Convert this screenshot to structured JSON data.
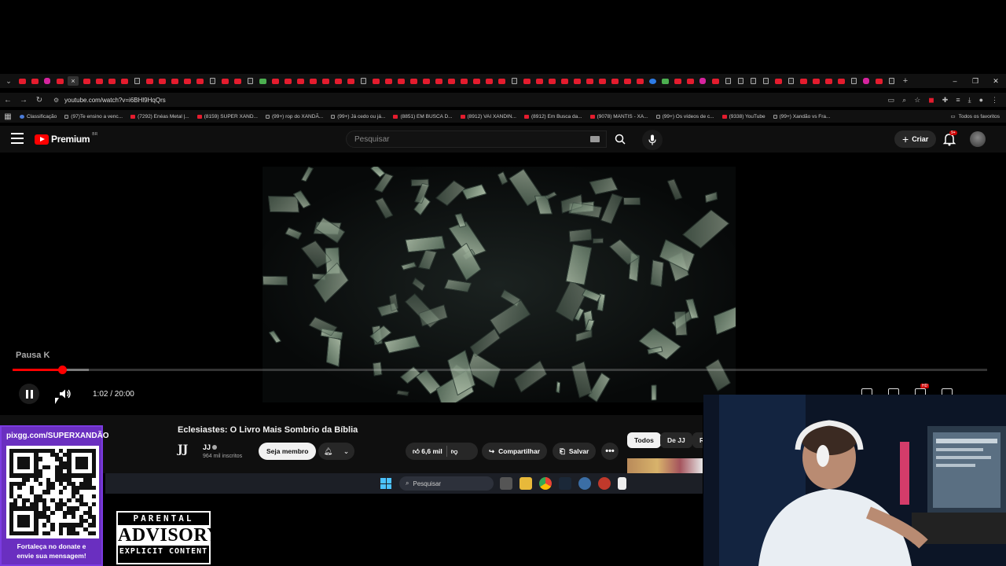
{
  "browser": {
    "url": "youtube.com/watch?v=i6BHl9HqQrs",
    "active_tab_close": "×",
    "new_tab": "+",
    "bookmarks": [
      {
        "label": "Classificação",
        "type": "bl"
      },
      {
        "label": "(97)Te ensino a venc...",
        "type": "tt"
      },
      {
        "label": "(7292) Enéas Metal |...",
        "type": "yt"
      },
      {
        "label": "(8159) SUPER XAND...",
        "type": "yt"
      },
      {
        "label": "(99+) rop do XANDÃ...",
        "type": "tt"
      },
      {
        "label": "(99+) Já cedo ou já...",
        "type": "tt"
      },
      {
        "label": "(8851) EM BUSCA D...",
        "type": "yt"
      },
      {
        "label": "(8912) VAI XANDIN...",
        "type": "yt"
      },
      {
        "label": "(8912) Em Busca da...",
        "type": "yt"
      },
      {
        "label": "(9078) MANTIS - XA...",
        "type": "yt"
      },
      {
        "label": "(99+) Os vídeos de c...",
        "type": "tt"
      },
      {
        "label": "(9338) YouTube",
        "type": "yt"
      },
      {
        "label": "(99+) Xandão vs Fra...",
        "type": "tt"
      }
    ],
    "all_favorites": "Todos os favoritos"
  },
  "youtube": {
    "brand": "Premium",
    "region": "BR",
    "search_placeholder": "Pesquisar",
    "create_label": "Criar",
    "notifications": "9+"
  },
  "player": {
    "pause_hint": "Pausa K",
    "time": "1:02 / 20:00",
    "progress_played": 0.051,
    "progress_loaded": 0.078,
    "hd_badge": "HD"
  },
  "video": {
    "title": "Eclesiastes: O Livro Mais Sombrio da Bíblia",
    "channel_logo": "JJ",
    "channel": "JJ",
    "subscribers": "964 mil inscritos",
    "join_label": "Seja membro",
    "likes": "6,6 mil",
    "share_label": "Compartilhar",
    "save_label": "Salvar",
    "more_label": "•••"
  },
  "chips": [
    "Todos",
    "De JJ",
    "R"
  ],
  "taskbar": {
    "search_placeholder": "Pesquisar"
  },
  "overlay": {
    "donate_url": "pixgg.com/SUPERXANDÃO",
    "donate_msg_1": "Fortaleça no donate e",
    "donate_msg_2": "envie sua mensagem!",
    "advisory_top": "PARENTAL",
    "advisory_mid": "ADVISORY",
    "advisory_bot": "EXPLICIT CONTENT"
  }
}
